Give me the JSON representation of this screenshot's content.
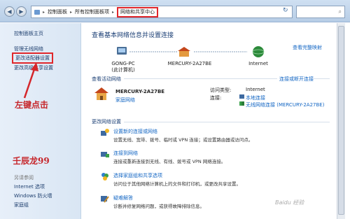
{
  "address_bar": {
    "segments": [
      "控制面板",
      "所有控制面板项"
    ],
    "current": "网络和共享中心"
  },
  "sidebar": {
    "items": [
      "控制面板主页",
      "管理无线网络",
      "更改适配器设置",
      "更改高级共享设置"
    ],
    "see_also_label": "另请参阅",
    "see_also": [
      "Internet 选项",
      "Windows 防火墙",
      "家庭组"
    ]
  },
  "annotations": {
    "arrow_text": "左键点击",
    "watermark": "壬辰龙99"
  },
  "main": {
    "title": "查看基本网络信息并设置连接",
    "full_map_link": "查看完整映射",
    "nodes": [
      {
        "name": "GONG-PC",
        "sub": "(此计算机)"
      },
      {
        "name": "MERCURY-2A27BE",
        "sub": ""
      },
      {
        "name": "Internet",
        "sub": ""
      }
    ],
    "active_heading": "查看活动网络",
    "connect_link": "连接或断开连接",
    "active_network": {
      "name": "MERCURY-2A27BE",
      "type": "家庭网络",
      "access_label": "访问类型:",
      "access_value": "Internet",
      "conn_label": "连接:",
      "conn_1": "本地连接",
      "conn_2": "无线网络连接 (MERCURY-2A27BE)"
    },
    "change_heading": "更改网络设置",
    "tasks": [
      {
        "title": "设置新的连接或网络",
        "desc": "设置无线、宽带、拨号、临时或 VPN 连接；或设置路由器或访问点。"
      },
      {
        "title": "连接到网络",
        "desc": "连接或重新连接到无线、有线、拨号或 VPN 网络连接。"
      },
      {
        "title": "选择家庭组和共享选项",
        "desc": "访问位于其他网络计算机上的文件和打印机，或更改共享设置。"
      },
      {
        "title": "疑难解答",
        "desc": "诊断并修复网络问题，或获得故障排除信息。"
      }
    ]
  },
  "watermark_site": "Baidu 经验"
}
